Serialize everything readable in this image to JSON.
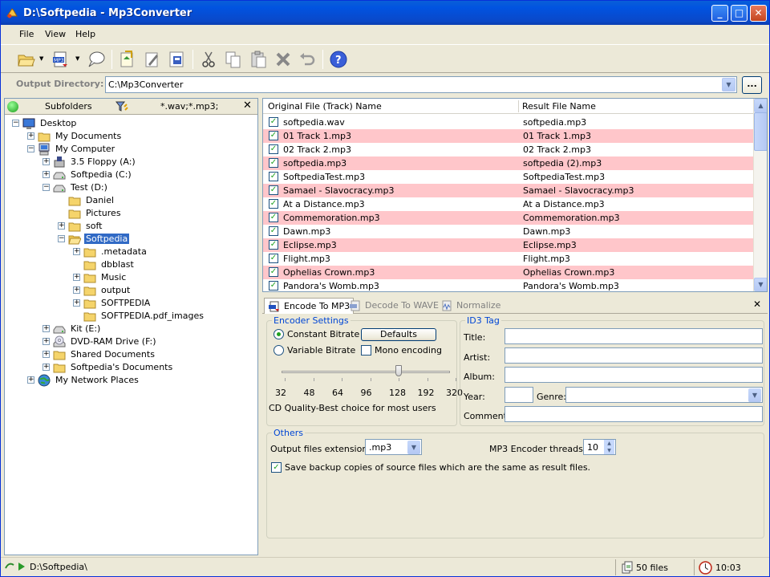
{
  "window": {
    "title": "D:\\Softpedia - Mp3Converter",
    "minimize": "_",
    "maximize": "□",
    "close": "✕"
  },
  "menu": [
    "File",
    "View",
    "Help"
  ],
  "output": {
    "label": "Output Directory:",
    "value": "C:\\Mp3Converter",
    "browse": "..."
  },
  "left_panel": {
    "subfolders_label": "Subfolders",
    "filter": "*.wav;*.mp3;",
    "close": "✕"
  },
  "tree": [
    {
      "label": "Desktop",
      "icon": "desktop-icon",
      "level": 0,
      "exp": "−"
    },
    {
      "label": "My Documents",
      "icon": "folder-icon",
      "level": 1,
      "exp": "+"
    },
    {
      "label": "My Computer",
      "icon": "computer-icon",
      "level": 1,
      "exp": "−"
    },
    {
      "label": "3.5 Floppy (A:)",
      "icon": "floppy-icon",
      "level": 2,
      "exp": "+"
    },
    {
      "label": "Softpedia (C:)",
      "icon": "drive-icon",
      "level": 2,
      "exp": "+"
    },
    {
      "label": "Test (D:)",
      "icon": "drive-icon",
      "level": 2,
      "exp": "−"
    },
    {
      "label": "Daniel",
      "icon": "folder-icon",
      "level": 3,
      "exp": ""
    },
    {
      "label": "Pictures",
      "icon": "folder-icon",
      "level": 3,
      "exp": ""
    },
    {
      "label": "soft",
      "icon": "folder-icon",
      "level": 3,
      "exp": "+"
    },
    {
      "label": "Softpedia",
      "icon": "folder-open-icon",
      "level": 3,
      "exp": "−",
      "selected": true
    },
    {
      "label": ".metadata",
      "icon": "folder-icon",
      "level": 4,
      "exp": "+"
    },
    {
      "label": "dbblast",
      "icon": "folder-icon",
      "level": 4,
      "exp": ""
    },
    {
      "label": "Music",
      "icon": "folder-icon",
      "level": 4,
      "exp": "+"
    },
    {
      "label": "output",
      "icon": "folder-icon",
      "level": 4,
      "exp": "+"
    },
    {
      "label": "SOFTPEDIA",
      "icon": "folder-icon",
      "level": 4,
      "exp": "+"
    },
    {
      "label": "SOFTPEDIA.pdf_images",
      "icon": "folder-icon",
      "level": 4,
      "exp": ""
    },
    {
      "label": "Kit (E:)",
      "icon": "drive-icon",
      "level": 2,
      "exp": "+"
    },
    {
      "label": "DVD-RAM Drive (F:)",
      "icon": "dvd-icon",
      "level": 2,
      "exp": "+"
    },
    {
      "label": "Shared Documents",
      "icon": "folder-icon",
      "level": 2,
      "exp": "+"
    },
    {
      "label": "Softpedia's Documents",
      "icon": "folder-icon",
      "level": 2,
      "exp": "+"
    },
    {
      "label": "My Network Places",
      "icon": "network-icon",
      "level": 1,
      "exp": "+"
    }
  ],
  "file_list": {
    "columns": [
      "Original File (Track) Name",
      "Result File Name"
    ],
    "rows": [
      {
        "original": "softpedia.wav",
        "result": "softpedia.mp3",
        "highlight": false,
        "checked": true
      },
      {
        "original": "01 Track 1.mp3",
        "result": "01 Track 1.mp3",
        "highlight": true,
        "checked": true
      },
      {
        "original": "02 Track 2.mp3",
        "result": "02 Track 2.mp3",
        "highlight": false,
        "checked": true
      },
      {
        "original": "softpedia.mp3",
        "result": "softpedia (2).mp3",
        "highlight": true,
        "checked": true
      },
      {
        "original": "SoftpediaTest.mp3",
        "result": "SoftpediaTest.mp3",
        "highlight": false,
        "checked": true
      },
      {
        "original": "Samael - Slavocracy.mp3",
        "result": "Samael - Slavocracy.mp3",
        "highlight": true,
        "checked": true
      },
      {
        "original": "At a Distance.mp3",
        "result": "At a Distance.mp3",
        "highlight": false,
        "checked": true
      },
      {
        "original": "Commemoration.mp3",
        "result": "Commemoration.mp3",
        "highlight": true,
        "checked": true
      },
      {
        "original": "Dawn.mp3",
        "result": "Dawn.mp3",
        "highlight": false,
        "checked": true
      },
      {
        "original": "Eclipse.mp3",
        "result": "Eclipse.mp3",
        "highlight": true,
        "checked": true
      },
      {
        "original": "Flight.mp3",
        "result": "Flight.mp3",
        "highlight": false,
        "checked": true
      },
      {
        "original": "Ophelias Crown.mp3",
        "result": "Ophelias Crown.mp3",
        "highlight": true,
        "checked": true
      },
      {
        "original": "Pandora's Womb.mp3",
        "result": "Pandora's Womb.mp3",
        "highlight": false,
        "checked": true
      }
    ]
  },
  "tabs": [
    {
      "label": "Encode To MP3",
      "active": true
    },
    {
      "label": "Decode To WAVE",
      "active": false
    },
    {
      "label": "Normalize",
      "active": false
    }
  ],
  "tab_close": "✕",
  "encoder": {
    "title": "Encoder Settings",
    "constant": "Constant Bitrate",
    "variable": "Variable Bitrate",
    "constant_selected": true,
    "defaults": "Defaults",
    "mono": "Mono encoding",
    "mono_checked": false,
    "bitrates": [
      "32",
      "48",
      "64",
      "96",
      "128",
      "192",
      "320"
    ],
    "bitrate_value": 128,
    "quality": "CD Quality-Best choice for most users"
  },
  "id3": {
    "title": "ID3 Tag",
    "title_label": "Title:",
    "artist_label": "Artist:",
    "album_label": "Album:",
    "year_label": "Year:",
    "genre_label": "Genre:",
    "comment_label": "Comment:"
  },
  "others": {
    "title": "Others",
    "ext_label": "Output files extension:",
    "ext_value": ".mp3",
    "threads_label": "MP3 Encoder threads:",
    "threads_value": "10",
    "backup_label": "Save backup copies of source files which are the same as result files.",
    "backup_checked": true
  },
  "status": {
    "path": "D:\\Softpedia\\",
    "files": "50 files",
    "time": "10:03"
  },
  "colors": {
    "titlebar": "#0153e0",
    "highlight_row": "#ffc6ca",
    "selection": "#316ac5",
    "group_title": "#0046d5"
  }
}
